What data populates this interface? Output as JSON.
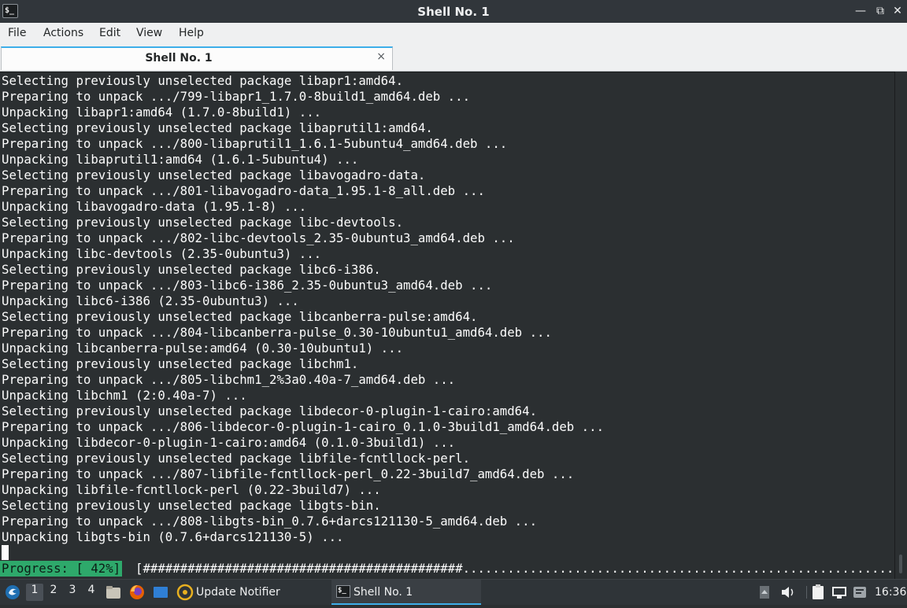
{
  "window": {
    "title": "Shell No. 1",
    "icon_text": "$_",
    "controls": {
      "minimize": "—",
      "maximize": "⧉",
      "close": "✕"
    }
  },
  "menu": [
    "File",
    "Actions",
    "Edit",
    "View",
    "Help"
  ],
  "tab": {
    "label": "Shell No. 1",
    "close": "×"
  },
  "terminal": {
    "lines": [
      "Selecting previously unselected package libapr1:amd64.",
      "Preparing to unpack .../799-libapr1_1.7.0-8build1_amd64.deb ...",
      "Unpacking libapr1:amd64 (1.7.0-8build1) ...",
      "Selecting previously unselected package libaprutil1:amd64.",
      "Preparing to unpack .../800-libaprutil1_1.6.1-5ubuntu4_amd64.deb ...",
      "Unpacking libaprutil1:amd64 (1.6.1-5ubuntu4) ...",
      "Selecting previously unselected package libavogadro-data.",
      "Preparing to unpack .../801-libavogadro-data_1.95.1-8_all.deb ...",
      "Unpacking libavogadro-data (1.95.1-8) ...",
      "Selecting previously unselected package libc-devtools.",
      "Preparing to unpack .../802-libc-devtools_2.35-0ubuntu3_amd64.deb ...",
      "Unpacking libc-devtools (2.35-0ubuntu3) ...",
      "Selecting previously unselected package libc6-i386.",
      "Preparing to unpack .../803-libc6-i386_2.35-0ubuntu3_amd64.deb ...",
      "Unpacking libc6-i386 (2.35-0ubuntu3) ...",
      "Selecting previously unselected package libcanberra-pulse:amd64.",
      "Preparing to unpack .../804-libcanberra-pulse_0.30-10ubuntu1_amd64.deb ...",
      "Unpacking libcanberra-pulse:amd64 (0.30-10ubuntu1) ...",
      "Selecting previously unselected package libchm1.",
      "Preparing to unpack .../805-libchm1_2%3a0.40a-7_amd64.deb ...",
      "Unpacking libchm1 (2:0.40a-7) ...",
      "Selecting previously unselected package libdecor-0-plugin-1-cairo:amd64.",
      "Preparing to unpack .../806-libdecor-0-plugin-1-cairo_0.1.0-3build1_amd64.deb ...",
      "Unpacking libdecor-0-plugin-1-cairo:amd64 (0.1.0-3build1) ...",
      "Selecting previously unselected package libfile-fcntllock-perl.",
      "Preparing to unpack .../807-libfile-fcntllock-perl_0.22-3build7_amd64.deb ...",
      "Unpacking libfile-fcntllock-perl (0.22-3build7) ...",
      "Selecting previously unselected package libgts-bin.",
      "Preparing to unpack .../808-libgts-bin_0.7.6+darcs121130-5_amd64.deb ...",
      "Unpacking libgts-bin (0.7.6+darcs121130-5) ..."
    ],
    "progress_label": "Progress: [ 42%]",
    "progress_bar": "[###########################################...........................................................]",
    "progress_percent": 42
  },
  "taskbar": {
    "desktops": [
      "1",
      "2",
      "3",
      "4"
    ],
    "active_desktop": "1",
    "tasks": [
      "Update Notifier",
      "Shell No. 1"
    ],
    "clock": "16:36"
  },
  "colors": {
    "terminal_bg": "#2b2f31",
    "terminal_fg": "#fcfcfc",
    "progress_highlight": "#2ea96b",
    "accent": "#3daee9"
  }
}
